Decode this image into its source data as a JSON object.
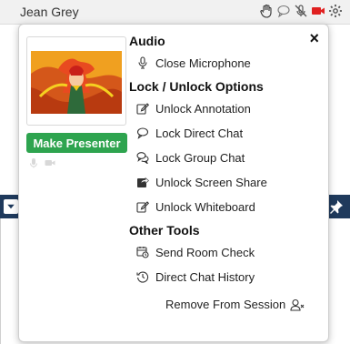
{
  "participant": {
    "name": "Jean Grey"
  },
  "top_icons": [
    "hand-raise-icon",
    "chat-bubble-icon",
    "mic-muted-icon",
    "camera-icon",
    "settings-gear-icon"
  ],
  "colors": {
    "presenter_button": "#2ea44f",
    "camera_icon": "#e02020",
    "strip": "#1f3a5c"
  },
  "popup": {
    "close_label": "×",
    "make_presenter_label": "Make Presenter",
    "sections": {
      "audio": {
        "title": "Audio",
        "items": [
          {
            "label": "Close Microphone",
            "icon": "microphone-icon"
          }
        ]
      },
      "lock": {
        "title": "Lock / Unlock Options",
        "items": [
          {
            "label": "Unlock Annotation",
            "icon": "edit-icon"
          },
          {
            "label": "Lock Direct Chat",
            "icon": "chat-bubble-icon"
          },
          {
            "label": "Lock Group Chat",
            "icon": "group-chat-icon"
          },
          {
            "label": "Unlock Screen Share",
            "icon": "share-icon"
          },
          {
            "label": "Unlock Whiteboard",
            "icon": "edit-icon"
          }
        ]
      },
      "other": {
        "title": "Other Tools",
        "items": [
          {
            "label": "Send Room Check",
            "icon": "room-check-icon"
          },
          {
            "label": "Direct Chat History",
            "icon": "history-icon"
          }
        ]
      }
    },
    "remove_label": "Remove From Session"
  }
}
